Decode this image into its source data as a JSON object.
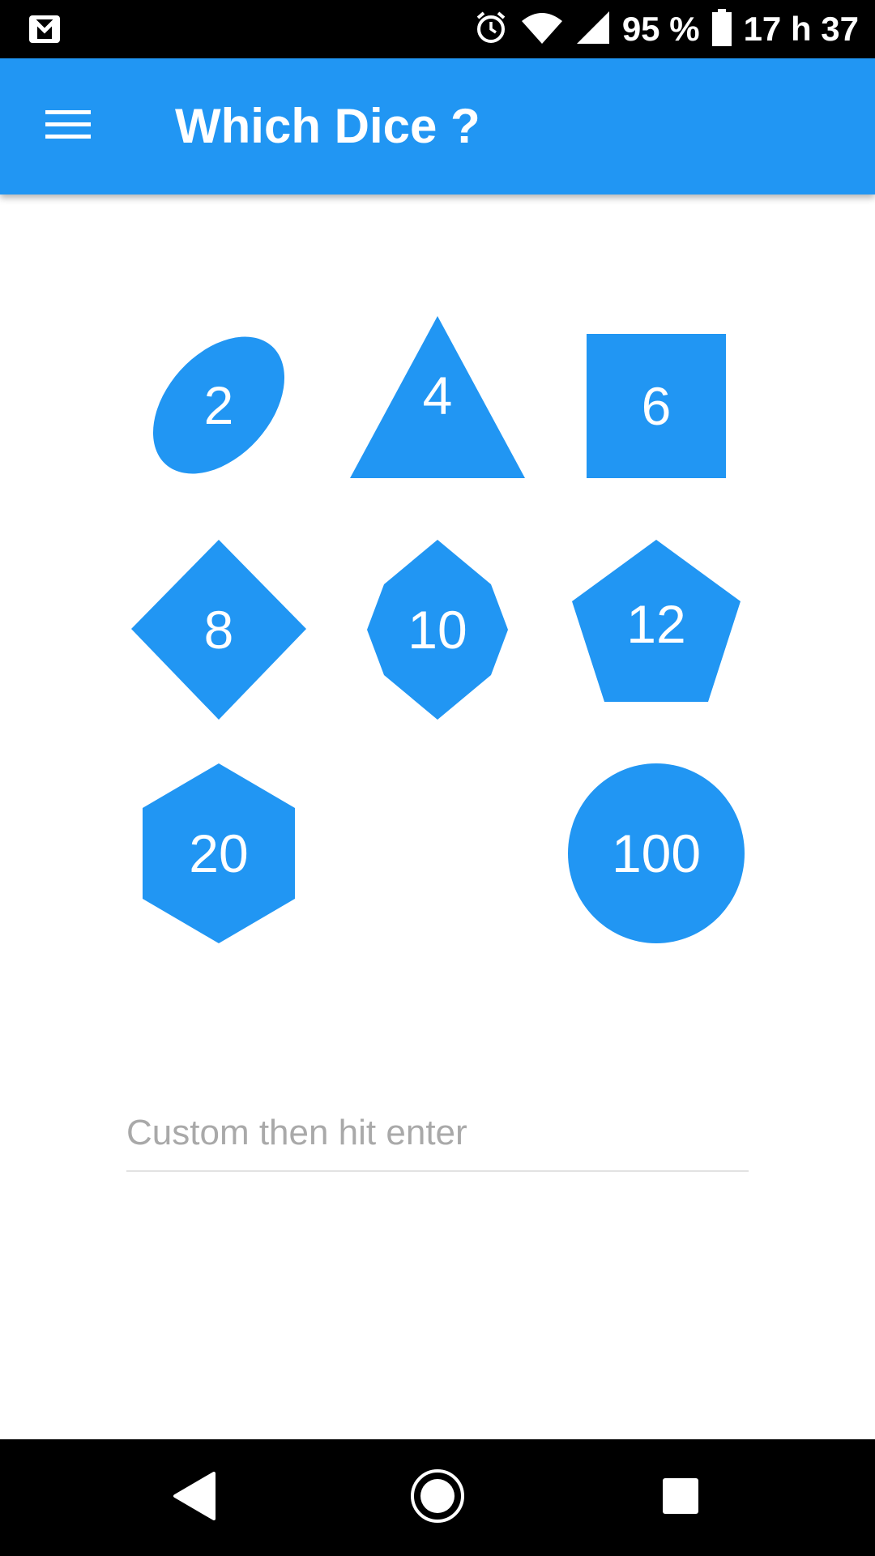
{
  "status_bar": {
    "battery_text": "95 %",
    "time": "17 h 37",
    "icons": [
      "gmail-icon",
      "alarm-icon",
      "wifi-icon",
      "signal-icon",
      "battery-icon"
    ]
  },
  "app_bar": {
    "title": "Which Dice ?",
    "menu_icon": "hamburger-menu-icon"
  },
  "dice": [
    {
      "sides": "2",
      "shape": "ellipse"
    },
    {
      "sides": "4",
      "shape": "triangle"
    },
    {
      "sides": "6",
      "shape": "square"
    },
    {
      "sides": "8",
      "shape": "diamond"
    },
    {
      "sides": "10",
      "shape": "octagon"
    },
    {
      "sides": "12",
      "shape": "pentagon"
    },
    {
      "sides": "20",
      "shape": "hexagon"
    },
    {
      "sides": "100",
      "shape": "circle"
    }
  ],
  "custom": {
    "placeholder": "Custom then hit enter",
    "value": ""
  },
  "nav_bar": {
    "icons": [
      "back-icon",
      "home-icon",
      "recents-icon"
    ]
  },
  "colors": {
    "accent": "#2196f3",
    "status_bar": "#000000",
    "nav_bar": "#000000",
    "background": "#ffffff"
  }
}
